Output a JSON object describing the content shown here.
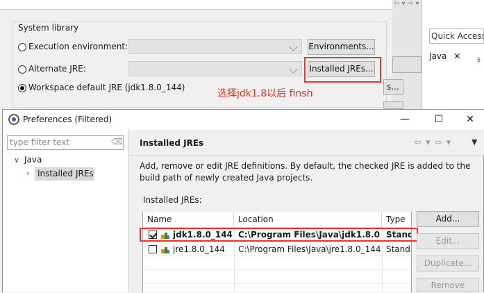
{
  "background_window": {
    "system_library": {
      "title": "System library",
      "options": [
        {
          "label": "Execution environment:",
          "selected": false
        },
        {
          "label": "Alternate JRE:",
          "selected": false
        },
        {
          "label": "Workspace default JRE (jdk1.8.0_144)",
          "selected": true
        }
      ],
      "environments_button": "Environments...",
      "installed_jres_button": "Installed JREs..."
    },
    "quick_access": "Quick Access",
    "java_tab": "Java",
    "java_tab_close": "✕",
    "sub_count": "5",
    "partial_button_text": "s..."
  },
  "annotation": "选择jdk1.8以后 finsh",
  "annotation_color": "#ea2d1f",
  "dialog": {
    "title": "Preferences (Filtered)",
    "window_buttons": {
      "minimize": "—",
      "maximize": "☐",
      "close": "✕"
    },
    "filter_placeholder": "type filter text",
    "tree": {
      "root": "Java",
      "child": "Installed JREs"
    },
    "page": {
      "title": "Installed JREs",
      "description": "Add, remove or edit JRE definitions. By default, the checked JRE is added to the build path of newly created Java projects.",
      "installed_label": "Installed JREs:",
      "columns": [
        "Name",
        "Location",
        "Type"
      ],
      "rows": [
        {
          "checked": true,
          "name": "jdk1.8.0_144...",
          "location": "C:\\Program Files\\Java\\jdk1.8.0...",
          "type": "Stand",
          "bold": true
        },
        {
          "checked": false,
          "name": "jre1.8.0_144",
          "location": "C:\\Program Files\\Java\\jre1.8.0_144",
          "type": "Standa",
          "bold": false
        }
      ],
      "buttons": {
        "add": "Add...",
        "edit": "Edit...",
        "duplicate": "Duplicate...",
        "remove": "Remove"
      }
    }
  }
}
